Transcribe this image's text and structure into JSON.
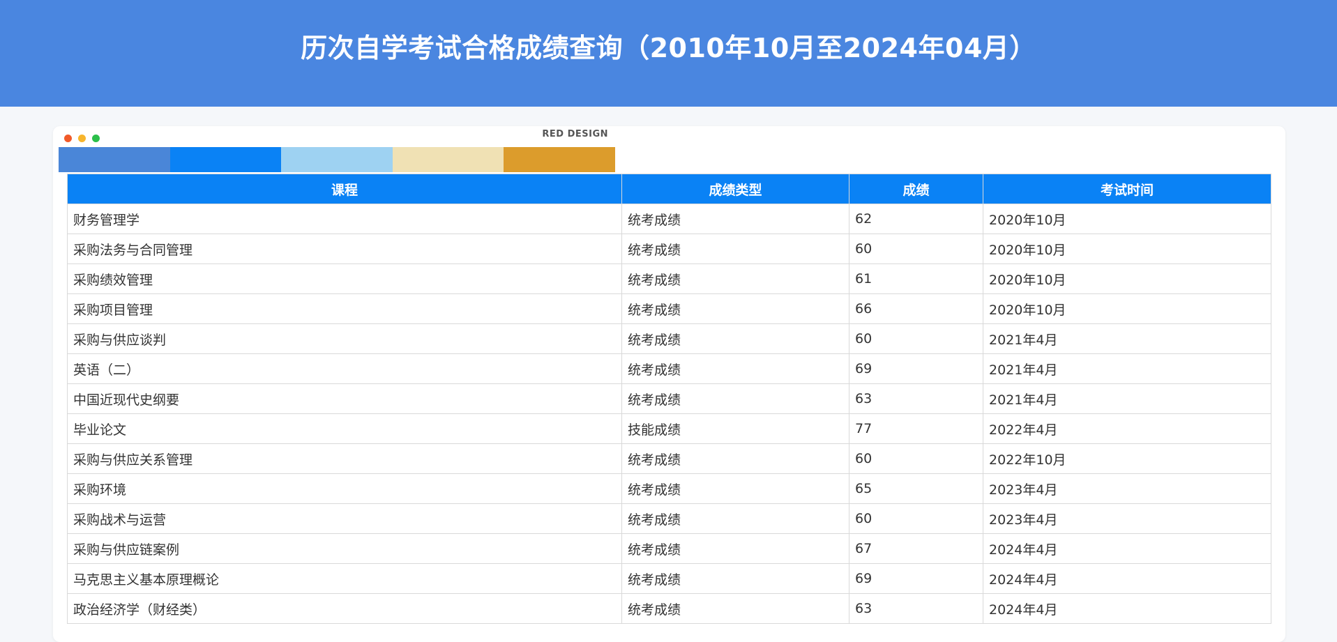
{
  "page_title": "历次自学考试合格成绩查询（2010年10月至2024年04月）",
  "design_strip": {
    "brand": "RED DESIGN",
    "dot_colors": [
      "#f15a29",
      "#f7b52c",
      "#2bbf4a"
    ],
    "swatch_colors": [
      "#4a86d8",
      "#0a82f5",
      "#9ed2f2",
      "#f0e1b4",
      "#dc9c2c"
    ]
  },
  "table": {
    "headers": [
      "课程",
      "成绩类型",
      "成绩",
      "考试时间"
    ],
    "rows": [
      {
        "course": "财务管理学",
        "type": "统考成绩",
        "score": "62",
        "time": "2020年10月"
      },
      {
        "course": "采购法务与合同管理",
        "type": "统考成绩",
        "score": "60",
        "time": "2020年10月"
      },
      {
        "course": "采购绩效管理",
        "type": "统考成绩",
        "score": "61",
        "time": "2020年10月"
      },
      {
        "course": "采购项目管理",
        "type": "统考成绩",
        "score": "66",
        "time": "2020年10月"
      },
      {
        "course": "采购与供应谈判",
        "type": "统考成绩",
        "score": "60",
        "time": "2021年4月"
      },
      {
        "course": "英语（二）",
        "type": "统考成绩",
        "score": "69",
        "time": "2021年4月"
      },
      {
        "course": "中国近现代史纲要",
        "type": "统考成绩",
        "score": "63",
        "time": "2021年4月"
      },
      {
        "course": "毕业论文",
        "type": "技能成绩",
        "score": "77",
        "time": "2022年4月"
      },
      {
        "course": "采购与供应关系管理",
        "type": "统考成绩",
        "score": "60",
        "time": "2022年10月"
      },
      {
        "course": "采购环境",
        "type": "统考成绩",
        "score": "65",
        "time": "2023年4月"
      },
      {
        "course": "采购战术与运营",
        "type": "统考成绩",
        "score": "60",
        "time": "2023年4月"
      },
      {
        "course": "采购与供应链案例",
        "type": "统考成绩",
        "score": "67",
        "time": "2024年4月"
      },
      {
        "course": "马克思主义基本原理概论",
        "type": "统考成绩",
        "score": "69",
        "time": "2024年4月"
      },
      {
        "course": "政治经济学（财经类）",
        "type": "统考成绩",
        "score": "63",
        "time": "2024年4月"
      }
    ]
  }
}
